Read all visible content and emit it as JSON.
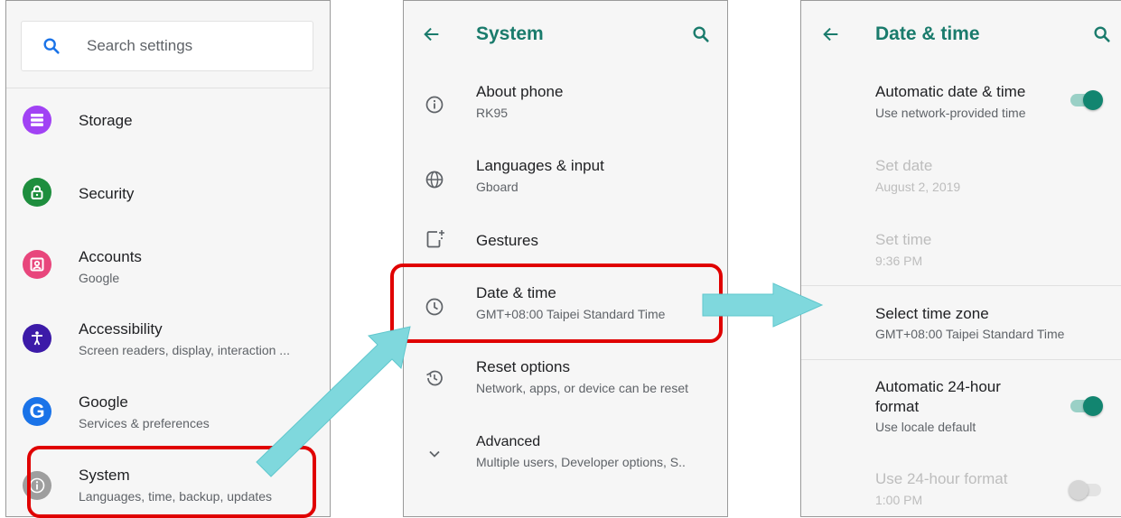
{
  "settings_panel": {
    "search_placeholder": "Search settings",
    "items": [
      {
        "title": "Storage",
        "subtitle": "",
        "icon": "storage-icon",
        "color": "#a142f4"
      },
      {
        "title": "Security",
        "subtitle": "",
        "icon": "lock-icon",
        "color": "#1e8e3e"
      },
      {
        "title": "Accounts",
        "subtitle": "Google",
        "icon": "account-box-icon",
        "color": "#e8467c"
      },
      {
        "title": "Accessibility",
        "subtitle": "Screen readers, display, interaction ...",
        "icon": "accessibility-icon",
        "color": "#3c1aa8"
      },
      {
        "title": "Google",
        "subtitle": "Services & preferences",
        "icon": "google-icon",
        "color": "#1a73e8"
      },
      {
        "title": "System",
        "subtitle": "Languages, time, backup, updates",
        "icon": "info-icon",
        "color": "#9e9e9e"
      }
    ]
  },
  "system_panel": {
    "title": "System",
    "items": [
      {
        "title": "About phone",
        "subtitle": "RK95",
        "icon": "info-outline-icon"
      },
      {
        "title": "Languages & input",
        "subtitle": "Gboard",
        "icon": "globe-icon"
      },
      {
        "title": "Gestures",
        "subtitle": "",
        "icon": "gestures-icon"
      },
      {
        "title": "Date & time",
        "subtitle": "GMT+08:00 Taipei Standard Time",
        "icon": "clock-icon"
      },
      {
        "title": "Reset options",
        "subtitle": "Network, apps, or device can be reset",
        "icon": "restore-icon"
      },
      {
        "title": "Advanced",
        "subtitle": "Multiple users, Developer options, S..",
        "icon": "chevron-down-icon"
      }
    ]
  },
  "datetime_panel": {
    "title": "Date & time",
    "items": [
      {
        "title": "Automatic date & time",
        "subtitle": "Use network-provided time",
        "enabled": true,
        "toggle": true
      },
      {
        "title": "Set date",
        "subtitle": "August 2, 2019",
        "enabled": false
      },
      {
        "title": "Set time",
        "subtitle": "9:36 PM",
        "enabled": false
      },
      {
        "title": "Select time zone",
        "subtitle": "GMT+08:00 Taipei Standard Time",
        "enabled": true
      },
      {
        "title_line1": "Automatic 24-hour",
        "title_line2": "format",
        "subtitle": "Use locale default",
        "enabled": true,
        "toggle": true
      },
      {
        "title": "Use 24-hour format",
        "subtitle": "1:00 PM",
        "enabled": false,
        "toggle": false
      }
    ]
  },
  "colors": {
    "accent": "#1a7b6c",
    "highlight": "#e00000",
    "arrow": "#7fd8dd"
  }
}
